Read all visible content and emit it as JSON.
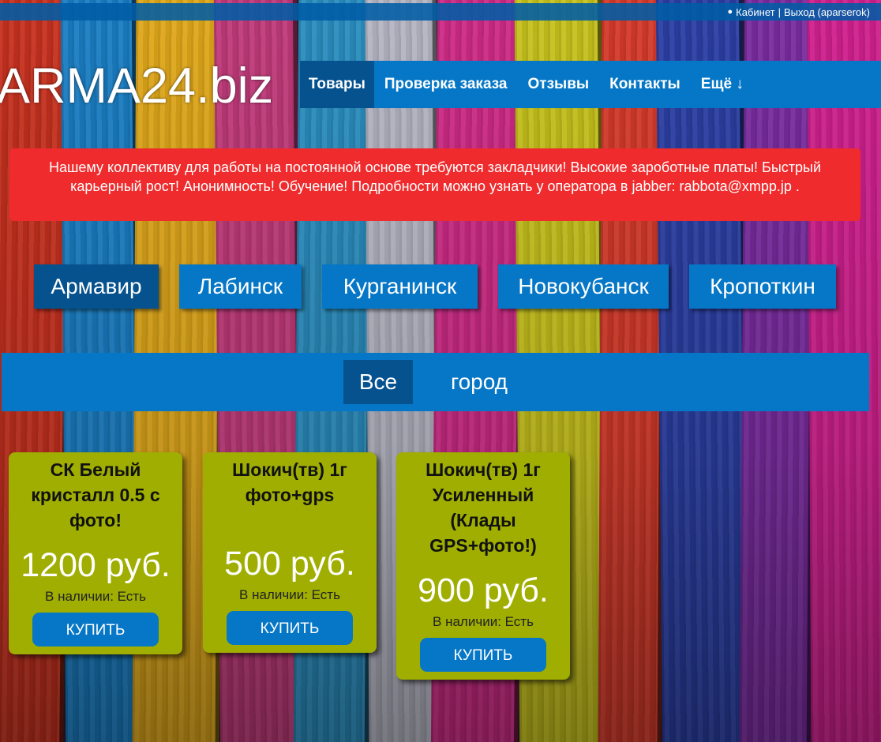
{
  "topbar": {
    "user_icon": "user-icon",
    "cabinet": "Кабинет",
    "separator": "|",
    "logout": "Выход (aparserok)"
  },
  "logo": "ARMA24.biz",
  "nav": [
    {
      "label": "Товары",
      "active": true
    },
    {
      "label": "Проверка заказа",
      "active": false
    },
    {
      "label": "Отзывы",
      "active": false
    },
    {
      "label": "Контакты",
      "active": false
    },
    {
      "label": "Ещё ↓",
      "active": false
    }
  ],
  "alert": {
    "text": "Нашему коллективу для работы на постоянной основе требуются закладчики! Высокие зароботные платы! Быстрый карьерный рост! Анонимность! Обучение! Подробности можно узнать у оператора в jabber: rabbota@xmpp.jp ."
  },
  "cities": [
    {
      "label": "Армавир",
      "active": true
    },
    {
      "label": "Лабинск",
      "active": false
    },
    {
      "label": "Курганинск",
      "active": false
    },
    {
      "label": "Новокубанск",
      "active": false
    },
    {
      "label": "Кропоткин",
      "active": false
    }
  ],
  "filters": [
    {
      "label": "Все",
      "active": true
    },
    {
      "label": "город",
      "active": false
    }
  ],
  "products": [
    {
      "title": "СК Белый кристалл 0.5 с фото!",
      "price": "1200 руб.",
      "stock": "В наличии: Есть",
      "buy": "КУПИТЬ"
    },
    {
      "title": "Шокич(тв) 1г фото+gps",
      "price": "500 руб.",
      "stock": "В наличии: Есть",
      "buy": "КУПИТЬ"
    },
    {
      "title": "Шокич(тв) 1г Усиленный (Клады GPS+фото!)",
      "price": "900 руб.",
      "stock": "В наличии: Есть",
      "buy": "КУПИТЬ"
    }
  ],
  "colors": {
    "nav_blue": "#0677c6",
    "nav_active": "#05528f",
    "alert_red": "#ef2b2d",
    "card_olive": "#9fae00"
  }
}
